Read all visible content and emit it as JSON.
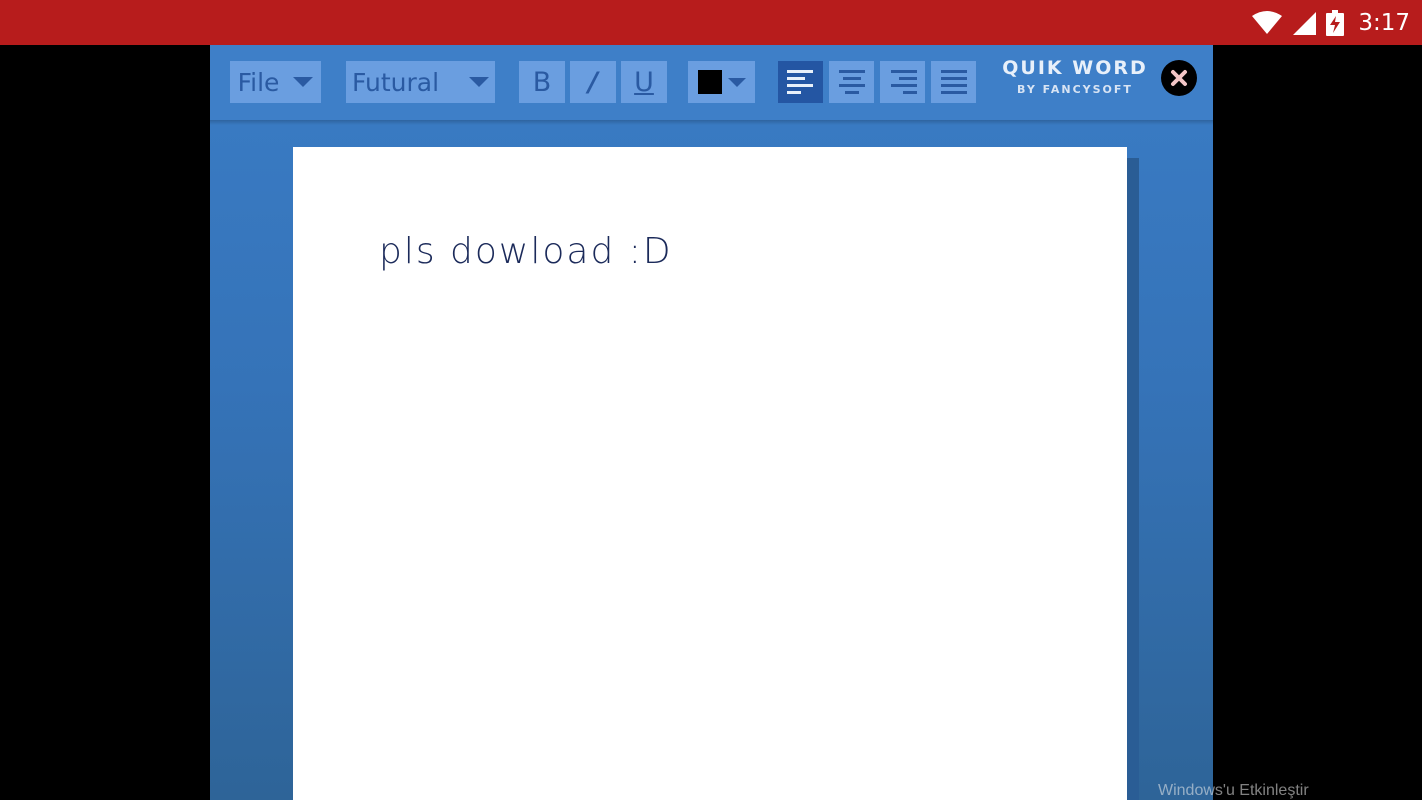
{
  "status_bar": {
    "time": "3:17",
    "color": "#b71c1c",
    "icons": [
      "wifi-icon",
      "cell-signal-icon",
      "battery-charging-icon"
    ]
  },
  "toolbar": {
    "file_menu": {
      "label": "File",
      "icon": "chevron-down-icon"
    },
    "font_select": {
      "selected": "Futural",
      "icon": "chevron-down-icon"
    },
    "format_buttons": {
      "bold": "B",
      "italic": "/",
      "underline": "U"
    },
    "text_color": {
      "value": "#000000",
      "icon": "chevron-down-icon"
    },
    "alignment": {
      "options": [
        "align-left-icon",
        "align-center-icon",
        "align-right-icon",
        "align-justify-icon"
      ],
      "selected": "align-left-icon"
    },
    "brand": {
      "title": "QUIK WORD",
      "subtitle": "BY FANCYSOFT"
    },
    "close_icon": "close-icon"
  },
  "document": {
    "text": "pls dowload :D"
  },
  "watermark": "Windows'u Etkinleştir",
  "colors": {
    "app_background": "#3a7cc5",
    "toolbar": "#3e7fc8",
    "button": "#6a9ee0",
    "button_active": "#2456a3",
    "page": "#ffffff"
  }
}
